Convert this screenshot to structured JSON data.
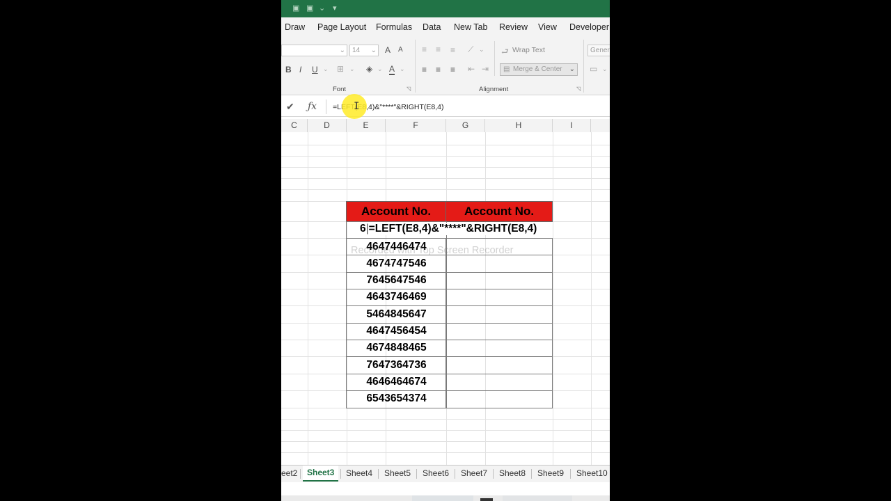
{
  "ribbon_tabs": [
    "Draw",
    "Page Layout",
    "Formulas",
    "Data",
    "New Tab",
    "Review",
    "View",
    "Developer"
  ],
  "font": {
    "size": "14",
    "group_label": "Font",
    "bold": "B",
    "italic": "I",
    "underline": "U",
    "grow": "A",
    "shrink": "A",
    "color": "A"
  },
  "alignment": {
    "wrap_text": "Wrap Text",
    "merge_center": "Merge & Center",
    "group_label": "Alignment"
  },
  "number": {
    "format": "Genera"
  },
  "formula_bar": {
    "formula": "=LEFT(E8,4)&\"****\"&RIGHT(E8,4)"
  },
  "columns": [
    "C",
    "D",
    "E",
    "F",
    "G",
    "H",
    "I"
  ],
  "table": {
    "header_left": "Account No.",
    "header_right": "Account No.",
    "header_color": "#e41b17",
    "editing_prefix": "6",
    "editing_formula": "=LEFT(E8,4)&\"****\"&RIGHT(E8,4)",
    "accounts": [
      "4647446474",
      "4674747546",
      "7645647546",
      "4643746469",
      "5464845647",
      "4647456454",
      "4674848465",
      "7647364736",
      "4646464674",
      "6543654374"
    ]
  },
  "watermark": "Recorded with Top Screen Recorder",
  "sheets": [
    "eet2",
    "Sheet3",
    "Sheet4",
    "Sheet5",
    "Sheet6",
    "Sheet7",
    "Sheet8",
    "Sheet9",
    "Sheet10"
  ],
  "active_sheet": "Sheet3",
  "accent_color": "#217346"
}
